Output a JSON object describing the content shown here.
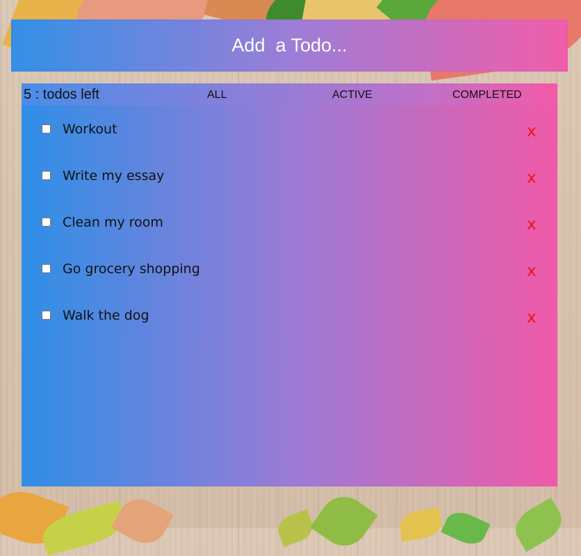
{
  "add_todo": {
    "placeholder": "Add  a Todo..."
  },
  "header": {
    "count_text": "5 : todos left",
    "filters": [
      "ALL",
      "ACTIVE",
      "COMPLETED"
    ]
  },
  "todos": [
    {
      "text": "Workout",
      "completed": false,
      "delete_label": "x"
    },
    {
      "text": "Write my essay",
      "completed": false,
      "delete_label": "x"
    },
    {
      "text": "Clean my room",
      "completed": false,
      "delete_label": "x"
    },
    {
      "text": "Go grocery shopping",
      "completed": false,
      "delete_label": "x"
    },
    {
      "text": "Walk the dog",
      "completed": false,
      "delete_label": "x"
    }
  ],
  "colors": {
    "gradient_start": "#2f8ee6",
    "gradient_mid": "#9a7bd6",
    "gradient_end": "#f05aa8",
    "delete": "#e8141c"
  }
}
